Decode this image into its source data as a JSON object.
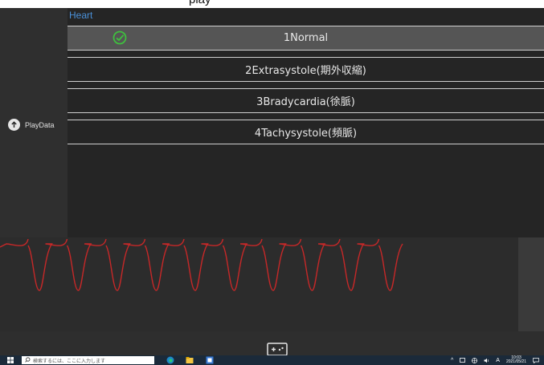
{
  "window": {
    "title": "play"
  },
  "panel": {
    "title": "Heart",
    "options": [
      {
        "label": "1Normal",
        "selected": true
      },
      {
        "label": "2Extrasystole(期外収縮)",
        "selected": false
      },
      {
        "label": "3Bradycardia(徐脈)",
        "selected": false
      },
      {
        "label": "4Tachysystole(頻脈)",
        "selected": false
      }
    ]
  },
  "left_rail": {
    "play_label": "PlayData",
    "play_icon": "arrow-up-circle-icon"
  },
  "chart": {
    "trace_color": "#c62828",
    "beats_visible": 10
  },
  "bottom": {
    "keyboard_icon": "gamepad-keyboard-icon"
  },
  "taskbar": {
    "search_placeholder": "検索するには、ここに入力します",
    "tray_letter": "A",
    "clock_time": "10:03",
    "clock_date": "2021/05/21"
  },
  "colors": {
    "accent": "#4a90d9",
    "check": "#3fbf3f",
    "selected_bg": "#555555"
  }
}
